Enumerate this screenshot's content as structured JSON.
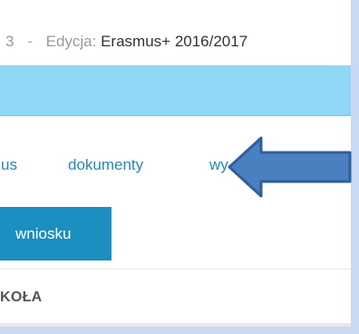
{
  "header": {
    "prefix_fragment": "3",
    "separator": "-",
    "edition_label": "Edycja:",
    "edition_value": "Erasmus+ 2016/2017"
  },
  "nav": {
    "items": [
      {
        "label": "us"
      },
      {
        "label": "dokumenty"
      },
      {
        "label": "wy"
      }
    ]
  },
  "action_button": {
    "label": "wniosku"
  },
  "section": {
    "title": "KOŁA"
  },
  "annotation": {
    "icon": "arrow-left-icon",
    "fill": "#4a7fc0",
    "stroke": "#2f5f9c"
  },
  "colors": {
    "page_bg": "#c9d8f3",
    "banner": "#8fd7f5",
    "button": "#1c8ec0",
    "link": "#2a86b5"
  }
}
